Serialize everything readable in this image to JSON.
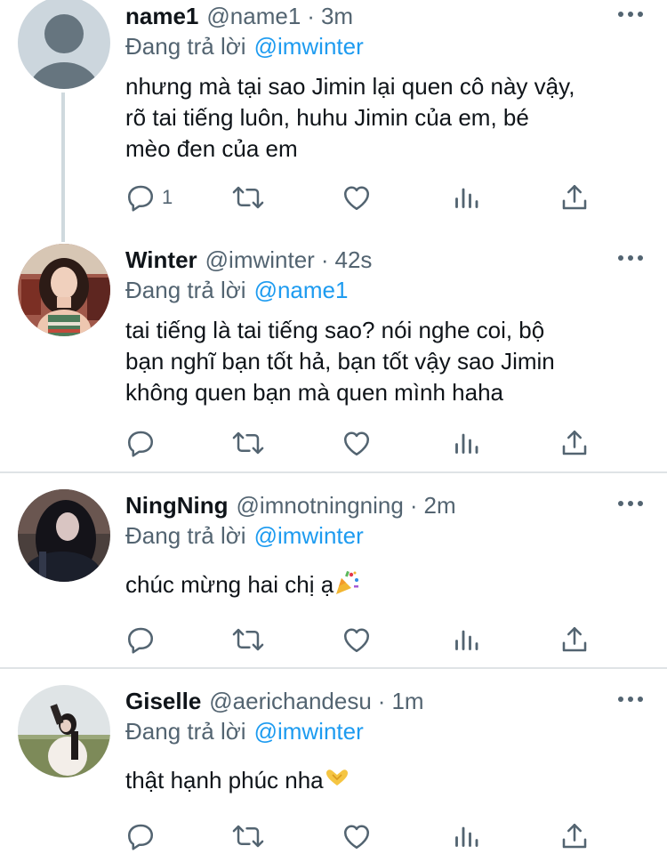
{
  "colors": {
    "text": "#0f1419",
    "secondary": "#536471",
    "mention": "#1d9bf0",
    "divider": "#dfe3e6",
    "thread_line": "#cfd9de"
  },
  "tweets": [
    {
      "name": "name1",
      "handle": "@name1",
      "separator": "·",
      "time": "3m",
      "replying_prefix": "Đang trả lời",
      "replying_to": "@imwinter",
      "text_lines": [
        "nhưng mà tại sao Jimin lại quen cô này vậy,",
        "rõ tai tiếng luôn, huhu Jimin của em, bé",
        "mèo đen của em"
      ],
      "reply_count": "1",
      "avatar": "default-avatar"
    },
    {
      "name": "Winter",
      "handle": "@imwinter",
      "separator": "·",
      "time": "42s",
      "replying_prefix": "Đang trả lời",
      "replying_to": "@name1",
      "text_lines": [
        "tai tiếng là tai tiếng sao? nói nghe coi, bộ",
        "bạn nghĩ bạn tốt hả, bạn tốt vậy sao Jimin",
        "không quen bạn mà quen mình haha"
      ],
      "reply_count": "",
      "avatar": "winter-photo"
    },
    {
      "name": "NingNing",
      "handle": "@imnotningning",
      "separator": "·",
      "time": "2m",
      "replying_prefix": "Đang trả lời",
      "replying_to": "@imwinter",
      "text_lines": [
        "chúc mừng hai chị ạ"
      ],
      "emoji": "party-popper",
      "reply_count": "",
      "avatar": "ningning-photo"
    },
    {
      "name": "Giselle",
      "handle": "@aerichandesu",
      "separator": "·",
      "time": "1m",
      "replying_prefix": "Đang trả lời",
      "replying_to": "@imwinter",
      "text_lines": [
        "thật hạnh phúc nha"
      ],
      "emoji": "heart-hands",
      "reply_count": "",
      "avatar": "giselle-photo"
    }
  ],
  "icons": [
    "reply-icon",
    "retweet-icon",
    "like-icon",
    "analytics-icon",
    "share-icon",
    "more-icon"
  ]
}
